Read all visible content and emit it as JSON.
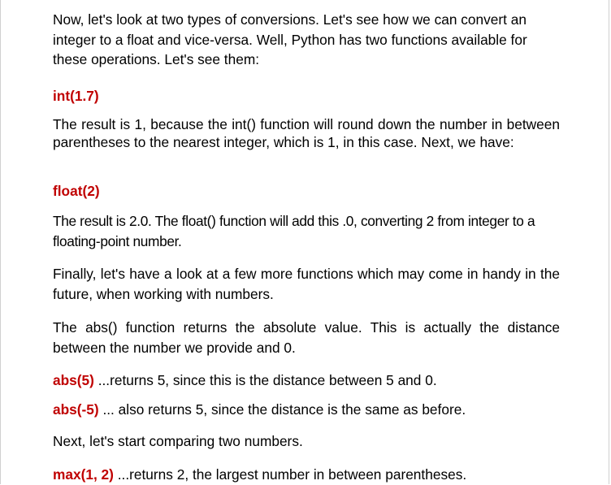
{
  "document": {
    "paragraphs": {
      "p1": "Now, let's look at two types of conversions. Let's see how we can convert an integer to a float and vice-versa. Well, Python has two functions available for these operations. Let's see them:",
      "code1": "int(1.7)",
      "p2": "The result is 1, because the int() function will round down the number in between parentheses to the nearest integer, which is 1, in this case. Next, we have:",
      "code2": "float(2)",
      "p3": "The result is 2.0. The float() function will add this .0, converting 2 from integer to a floating-point number.",
      "p4": "Finally, let's have a look at a few more functions which may come in handy in the future, when working with numbers.",
      "p5": "The abs() function returns the absolute value. This is actually the distance between the number we provide and 0.",
      "line6_code": "abs(5)",
      "line6_text": " ...returns 5, since this is the distance between 5 and 0.",
      "line7_code": "abs(-5)",
      "line7_text": " ... also returns 5, since the distance is the same as before.",
      "p8": "Next, let's start comparing two numbers.",
      "line9_code": "max(1, 2)",
      "line9_text": " ...returns 2, the largest number in between parentheses."
    }
  }
}
